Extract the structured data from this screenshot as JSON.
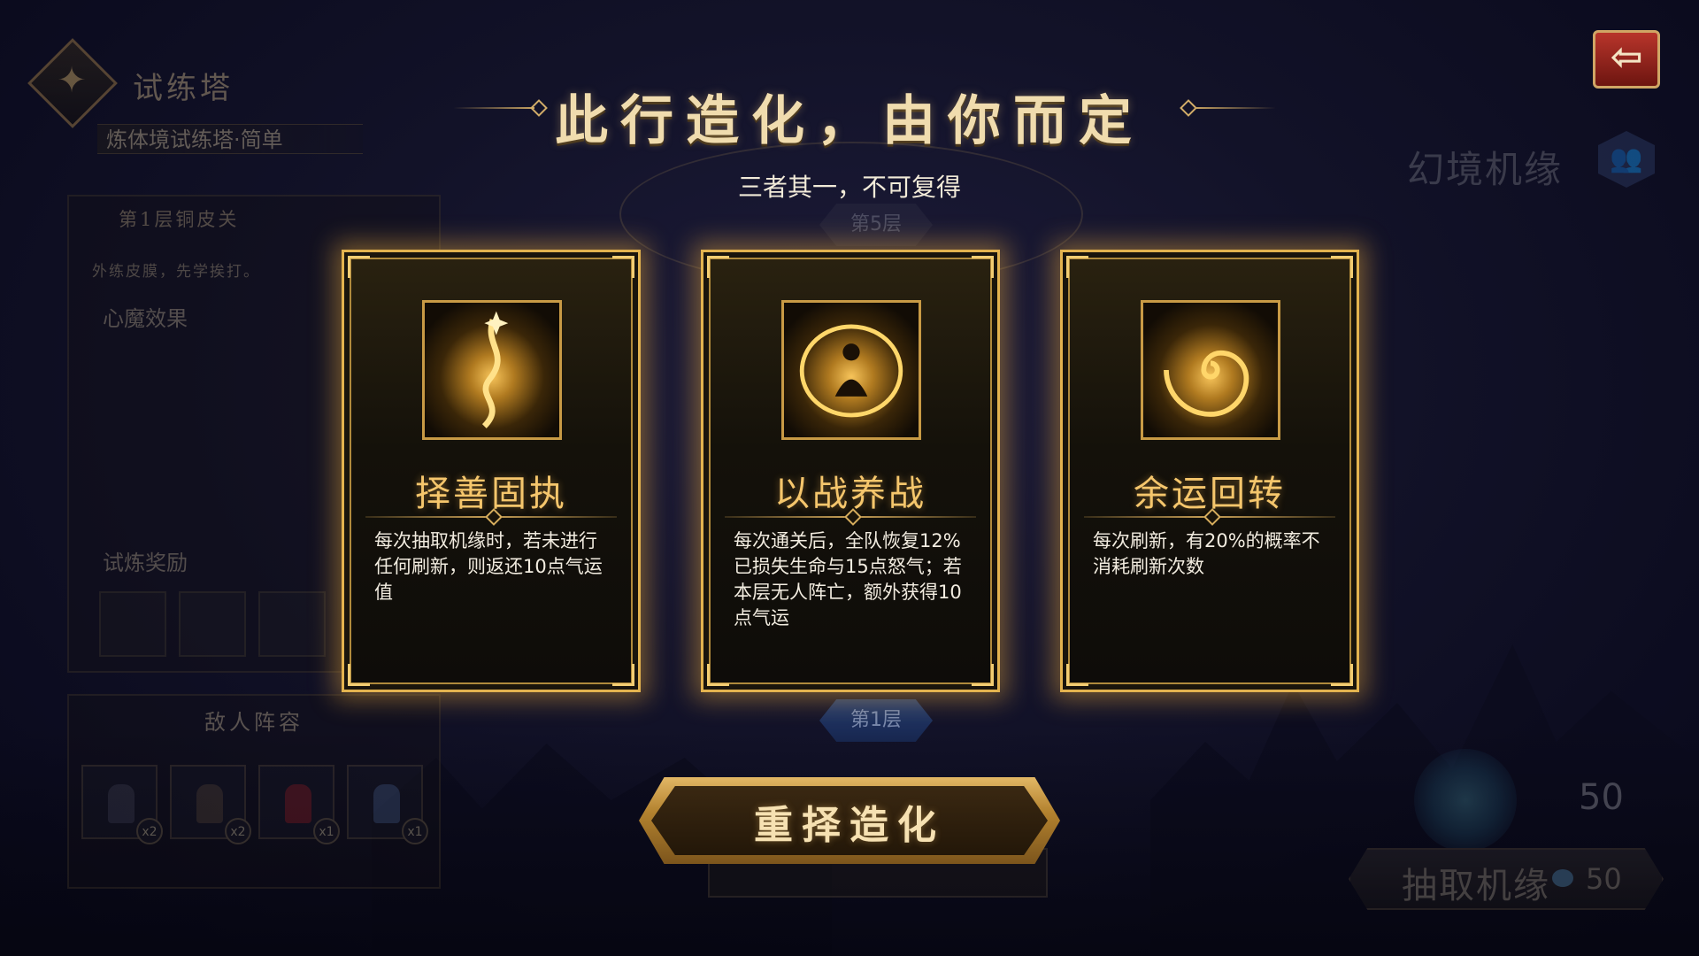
{
  "left_panel": {
    "tower_title": "试练塔",
    "tower_subtitle": "炼体境试练塔·简单",
    "floor_name": "第1层铜皮关",
    "floor_desc": "外练皮膜，先学挨打。",
    "section_demon": "心魔效果",
    "section_reward": "试炼奖励",
    "enemy_title": "敌人阵容",
    "enemies": [
      {
        "icon": "warrior-icon",
        "count": "x2",
        "color": "#3a3b48"
      },
      {
        "icon": "monk-icon",
        "count": "x2",
        "color": "#4a3d33"
      },
      {
        "icon": "red-figure-icon",
        "count": "x1",
        "color": "#7a1f22"
      },
      {
        "icon": "beast-icon",
        "count": "x1",
        "color": "#3e4f70"
      }
    ]
  },
  "top_right": {
    "back_icon": "back-arrow-icon",
    "back_glyph": "⇦",
    "huanjing_label": "幻境机缘",
    "huanjing_icon": "group-icon",
    "huanjing_glyph": "👥"
  },
  "floor_markers": {
    "top": "第5层",
    "bottom": "第1层"
  },
  "heading": {
    "title": "此行造化，由你而定",
    "subtitle": "三者其一，不可复得"
  },
  "cards": [
    {
      "icon": "golden-flame-icon",
      "title": "择善固执",
      "desc": "每次抽取机缘时，若未进行任何刷新，则返还10点气运值"
    },
    {
      "icon": "meditating-figure-icon",
      "title": "以战养战",
      "desc": "每次通关后，全队恢复12%已损失生命与15点怒气；若本层无人阵亡，额外获得10点气运"
    },
    {
      "icon": "swirl-vortex-icon",
      "title": "余运回转",
      "desc": "每次刷新，有20%的概率不消耗刷新次数"
    }
  ],
  "main_button": {
    "label": "重择造化"
  },
  "bottom_right": {
    "orb_count": "50",
    "draw_label": "抽取机缘",
    "draw_count": "50",
    "draw_icon": "spirit-gem-icon"
  }
}
